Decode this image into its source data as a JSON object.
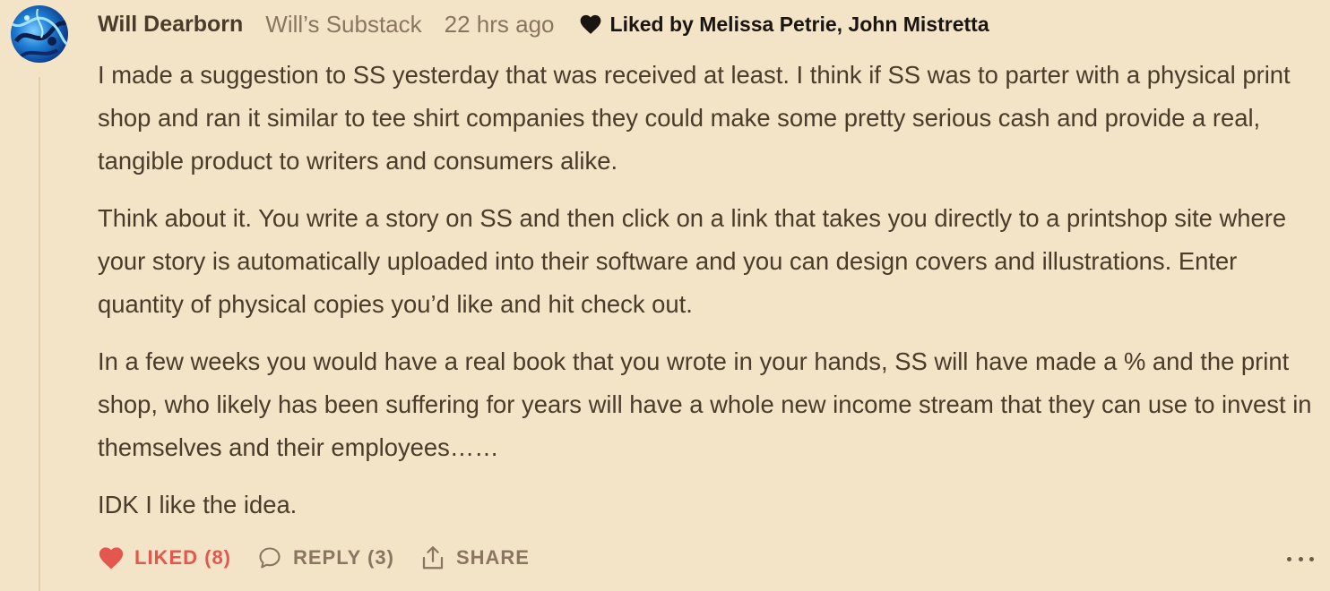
{
  "comment": {
    "author": "Will Dearborn",
    "publication": "Will’s Substack",
    "timestamp": "22 hrs ago",
    "liked_by": "Liked by Melissa Petrie, John Mistretta",
    "paragraphs": [
      "I made a suggestion to SS yesterday that was received at least. I think if SS was to parter with a physical print shop and ran it similar to tee shirt companies they could make some pretty serious cash and provide a real, tangible product to writers and consumers alike.",
      "Think about it. You write a story on SS and then click on a link that takes you directly to a printshop site where your story is automatically uploaded into their software and you can design covers and illustrations. Enter quantity of physical copies you’d like and hit check out.",
      "In a few weeks you would have a real book that you wrote in your hands, SS will have made a % and the print shop, who likely has been suffering for years will have a whole new income stream that they can use to invest in themselves and their employees……",
      "IDK I like the idea."
    ]
  },
  "actions": {
    "like_label": "LIKED (8)",
    "reply_label": "REPLY (3)",
    "share_label": "SHARE"
  },
  "icons": {
    "avatar": "avatar-image",
    "liked_by": "heart-icon",
    "like": "heart-icon",
    "reply": "speech-bubble-icon",
    "share": "share-icon",
    "more": "more-dots-icon"
  },
  "colors": {
    "background": "#f3e4c8",
    "text": "#4a3b2a",
    "muted": "#8a7660",
    "liked": "#e4574f"
  }
}
